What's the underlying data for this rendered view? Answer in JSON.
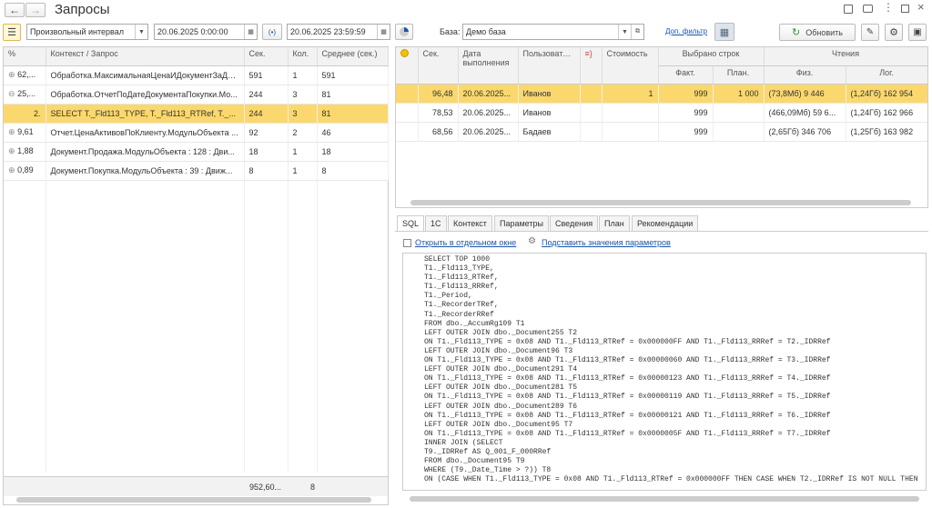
{
  "title": "Запросы",
  "nav": {
    "back": "←",
    "forward": "→"
  },
  "toolbar": {
    "interval": "Произвольный интервал",
    "date_from": "20.06.2025  0:00:00",
    "date_to": "20.06.2025 23:59:59",
    "base_label": "База:",
    "base_value": "Демо база",
    "extra_filter": "Доп. фильтр",
    "refresh": "Обновить"
  },
  "left_table": {
    "headers": [
      "%",
      "Контекст / Запрос",
      "Сек.",
      "Кол.",
      "Среднее (сек.)"
    ],
    "rows": [
      {
        "pct": "62,...",
        "ctx": "Обработка.МаксимальнаяЦенаИДокументЗаДе...",
        "sec": "591",
        "cnt": "1",
        "avg": "591",
        "tree": "⊕"
      },
      {
        "pct": "25,...",
        "ctx": "Обработка.ОтчетПоДатеДокументаПокупки.Мо...",
        "sec": "244",
        "cnt": "3",
        "avg": "81",
        "tree": "⊖"
      },
      {
        "pct": "2.",
        "ctx": "SELECT T._Fld113_TYPE, T._Fld113_RTRef, T._...",
        "sec": "244",
        "cnt": "3",
        "avg": "81",
        "tree": ""
      },
      {
        "pct": "9,61",
        "ctx": "Отчет.ЦенаАктивовПоКлиенту.МодульОбъекта ...",
        "sec": "92",
        "cnt": "2",
        "avg": "46",
        "tree": "⊕"
      },
      {
        "pct": "1,88",
        "ctx": "Документ.Продажа.МодульОбъекта : 128 : Дви...",
        "sec": "18",
        "cnt": "1",
        "avg": "18",
        "tree": "⊕"
      },
      {
        "pct": "0,89",
        "ctx": "Документ.Покупка.МодульОбъекта : 39 : Движ...",
        "sec": "8",
        "cnt": "1",
        "avg": "8",
        "tree": "⊕"
      }
    ],
    "total_sec": "952,60...",
    "total_cnt": "8"
  },
  "right_table": {
    "h_sec": "Сек.",
    "h_date": "Дата выполнения",
    "h_user": "Пользователь",
    "h_cost": "Стоимость",
    "h_rows": "Выбрано строк",
    "h_fact": "Факт.",
    "h_plan": "План.",
    "h_reads": "Чтения",
    "h_phys": "Физ.",
    "h_log": "Лог.",
    "rows": [
      {
        "sec": "96,48",
        "date": "20.06.2025...",
        "user": "Иванов",
        "cost": "1",
        "fact": "999",
        "plan": "1 000",
        "phys": "(73,8Мб) 9 446",
        "log": "(1,24Гб) 162 954"
      },
      {
        "sec": "78,53",
        "date": "20.06.2025...",
        "user": "Иванов",
        "cost": "",
        "fact": "999",
        "plan": "",
        "phys": "(466,09Мб) 59 6...",
        "log": "(1,24Гб) 162 966"
      },
      {
        "sec": "68,56",
        "date": "20.06.2025...",
        "user": "Бадаев",
        "cost": "",
        "fact": "999",
        "plan": "",
        "phys": "(2,65Гб) 346 706",
        "log": "(1,25Гб) 163 982"
      }
    ]
  },
  "tabs": [
    "SQL",
    "1С",
    "Контекст",
    "Параметры",
    "Сведения",
    "План",
    "Рекомендации"
  ],
  "links": {
    "open_window": "Открыть в отдельном окне",
    "substitute": "Подставить значения параметров"
  },
  "sql": "SELECT TOP 1000\nT1._Fld113_TYPE,\nT1._Fld113_RTRef,\nT1._Fld113_RRRef,\nT1._Period,\nT1._RecorderTRef,\nT1._RecorderRRef\nFROM dbo._AccumRg109 T1\nLEFT OUTER JOIN dbo._Document255 T2\nON T1._Fld113_TYPE = 0x08 AND T1._Fld113_RTRef = 0x000000FF AND T1._Fld113_RRRef = T2._IDRRef\nLEFT OUTER JOIN dbo._Document96 T3\nON T1._Fld113_TYPE = 0x08 AND T1._Fld113_RTRef = 0x00000060 AND T1._Fld113_RRRef = T3._IDRRef\nLEFT OUTER JOIN dbo._Document291 T4\nON T1._Fld113_TYPE = 0x08 AND T1._Fld113_RTRef = 0x00000123 AND T1._Fld113_RRRef = T4._IDRRef\nLEFT OUTER JOIN dbo._Document281 T5\nON T1._Fld113_TYPE = 0x08 AND T1._Fld113_RTRef = 0x00000119 AND T1._Fld113_RRRef = T5._IDRRef\nLEFT OUTER JOIN dbo._Document289 T6\nON T1._Fld113_TYPE = 0x08 AND T1._Fld113_RTRef = 0x00000121 AND T1._Fld113_RRRef = T6._IDRRef\nLEFT OUTER JOIN dbo._Document95 T7\nON T1._Fld113_TYPE = 0x08 AND T1._Fld113_RTRef = 0x0000005F AND T1._Fld113_RRRef = T7._IDRRef\nINNER JOIN (SELECT\nT9._IDRRef AS Q_001_F_000RRef\nFROM dbo._Document95 T9\nWHERE (T9._Date_Time > ?)) T8\nON (CASE WHEN T1._Fld113_TYPE = 0x08 AND T1._Fld113_RTRef = 0x000000FF THEN CASE WHEN T2._IDRRef IS NOT NULL THEN",
  "colors": {
    "selected": "#fbd86e",
    "link": "#1a55a8",
    "refresh_icon": "#2e9a3a"
  }
}
